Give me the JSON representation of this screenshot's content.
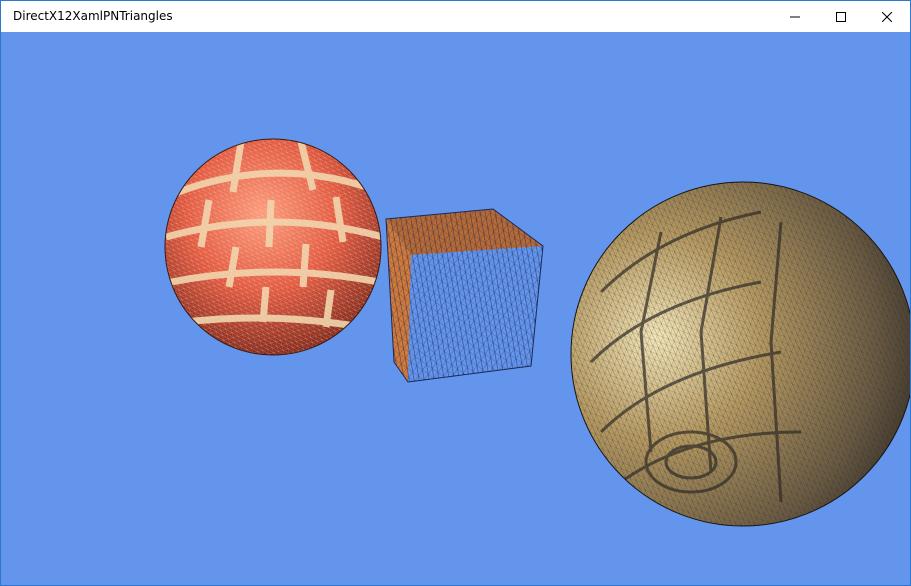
{
  "window": {
    "title": "DirectX12XamlPNTriangles",
    "background_color": "#6495ed",
    "controls": [
      "minimize-icon",
      "maximize-icon",
      "close-icon"
    ]
  },
  "scene": {
    "objects": [
      {
        "name": "brick-sphere",
        "texture": "red brick with cream mortar",
        "wireframe": true
      },
      {
        "name": "wireframe-cube",
        "texture": "orange",
        "wireframe": true
      },
      {
        "name": "stone-sphere",
        "texture": "stone tiles",
        "wireframe": true
      }
    ],
    "colors": {
      "brick": "#d9553a",
      "mortar": "#f3d4a6",
      "stone": "#a88a55",
      "wire": "#1b2a55"
    }
  }
}
